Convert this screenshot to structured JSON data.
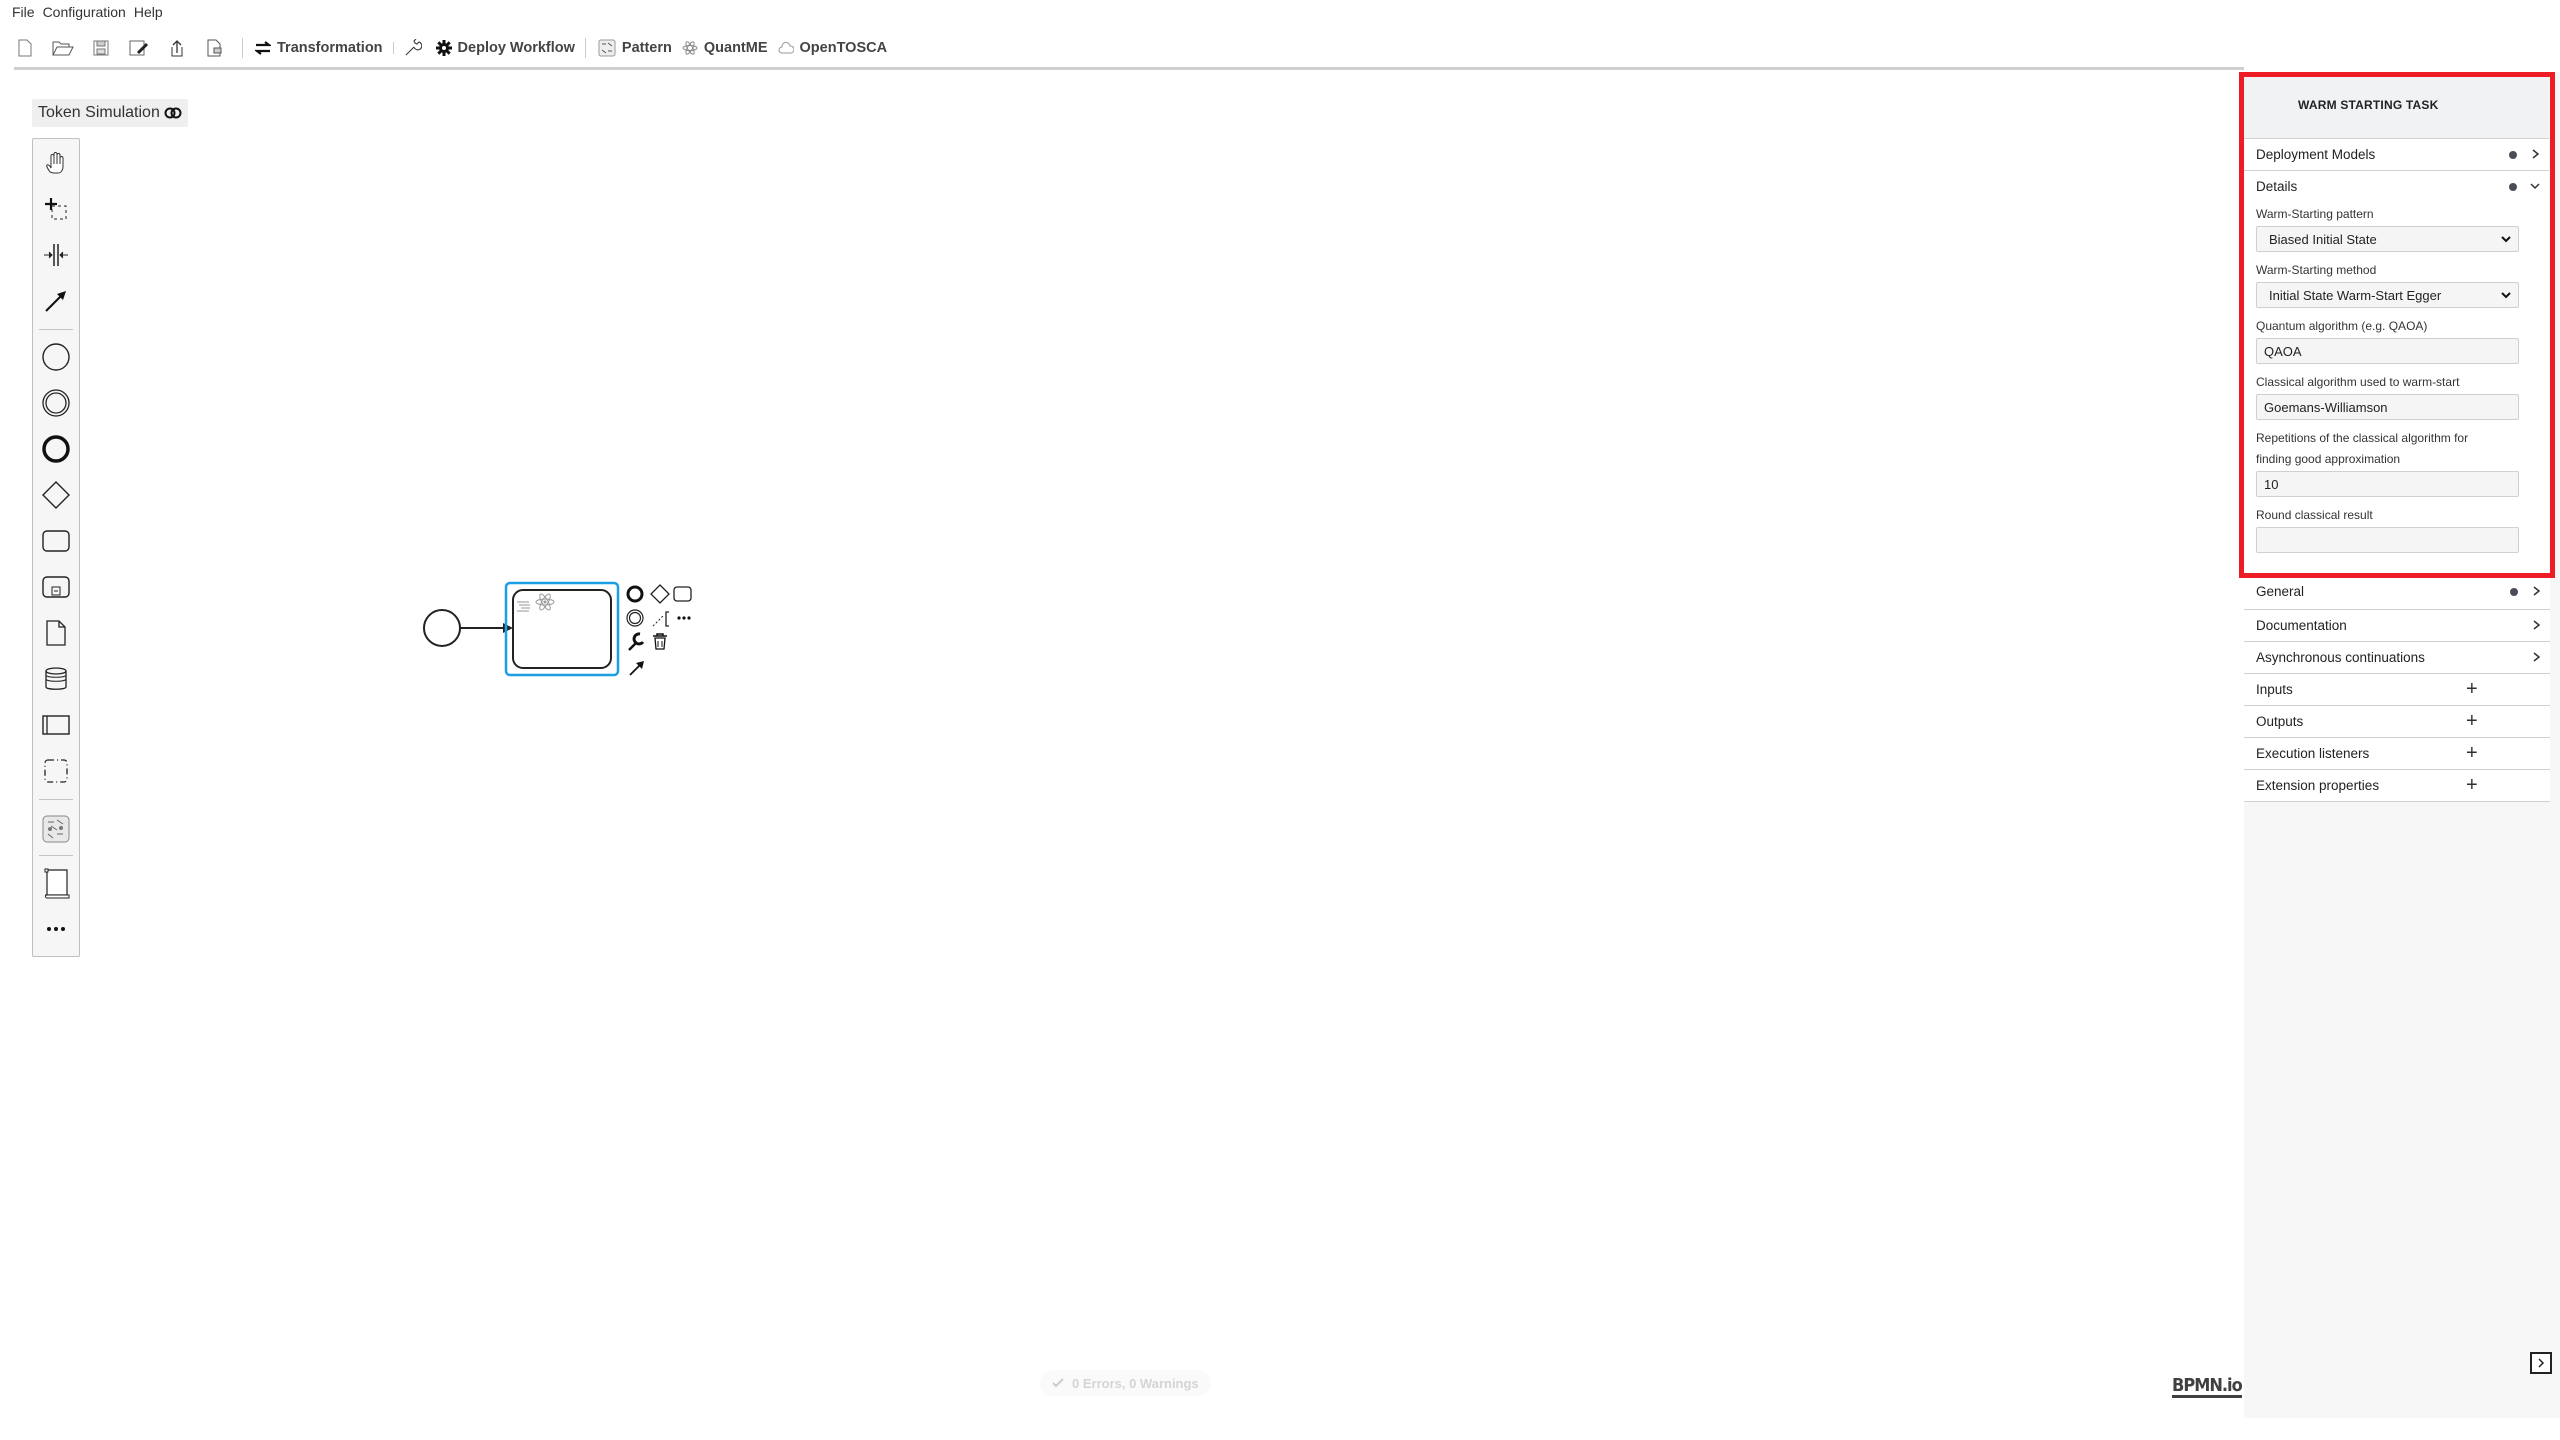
{
  "menu": [
    "File",
    "Configuration",
    "Help"
  ],
  "toolbar": {
    "file_icons": [
      "new-file-icon",
      "open-folder-icon",
      "save-icon",
      "save-as-icon",
      "export-icon",
      "deploy-file-icon"
    ],
    "transformation": "Transformation",
    "deploy_workflow": "Deploy Workflow",
    "pattern": "Pattern",
    "quantme": "QuantME",
    "opentosca": "OpenTOSCA"
  },
  "token_simulation": "Token Simulation",
  "palette": [
    "hand-tool",
    "lasso-tool",
    "space-tool",
    "global-connect-tool",
    "start-event",
    "intermediate-event",
    "end-event",
    "gateway",
    "task",
    "subprocess",
    "data-object",
    "data-store",
    "pool",
    "group",
    "pattern",
    "text-annotation",
    "more"
  ],
  "properties": {
    "title": "WARM STARTING TASK",
    "groups": [
      {
        "label": "Deployment Models",
        "dot": true,
        "state": "collapsed"
      },
      {
        "label": "Details",
        "dot": true,
        "state": "expanded"
      }
    ],
    "details": {
      "pattern_label": "Warm-Starting pattern",
      "pattern_value": "Biased Initial State",
      "method_label": "Warm-Starting method",
      "method_value": "Initial State Warm-Start Egger",
      "quantum_label": "Quantum algorithm (e.g. QAOA)",
      "quantum_value": "QAOA",
      "classical_label": "Classical algorithm used to warm-start",
      "classical_value": "Goemans-Williamson",
      "repetitions_label_1": "Repetitions of the classical algorithm for",
      "repetitions_label_2": "finding good approximation",
      "repetitions_value": "10",
      "round_label": "Round classical result",
      "round_value": ""
    },
    "lower_groups": [
      {
        "label": "General",
        "dot": true,
        "type": "chevron"
      },
      {
        "label": "Documentation",
        "dot": false,
        "type": "chevron"
      },
      {
        "label": "Asynchronous continuations",
        "dot": false,
        "type": "chevron"
      },
      {
        "label": "Inputs",
        "type": "plus"
      },
      {
        "label": "Outputs",
        "type": "plus"
      },
      {
        "label": "Execution listeners",
        "type": "plus"
      },
      {
        "label": "Extension properties",
        "type": "plus"
      }
    ]
  },
  "status_bar": "0 Errors, 0 Warnings",
  "logo": "BPMN.io",
  "colors": {
    "highlight": "#ee1c25",
    "selection": "#1a9fe6"
  }
}
